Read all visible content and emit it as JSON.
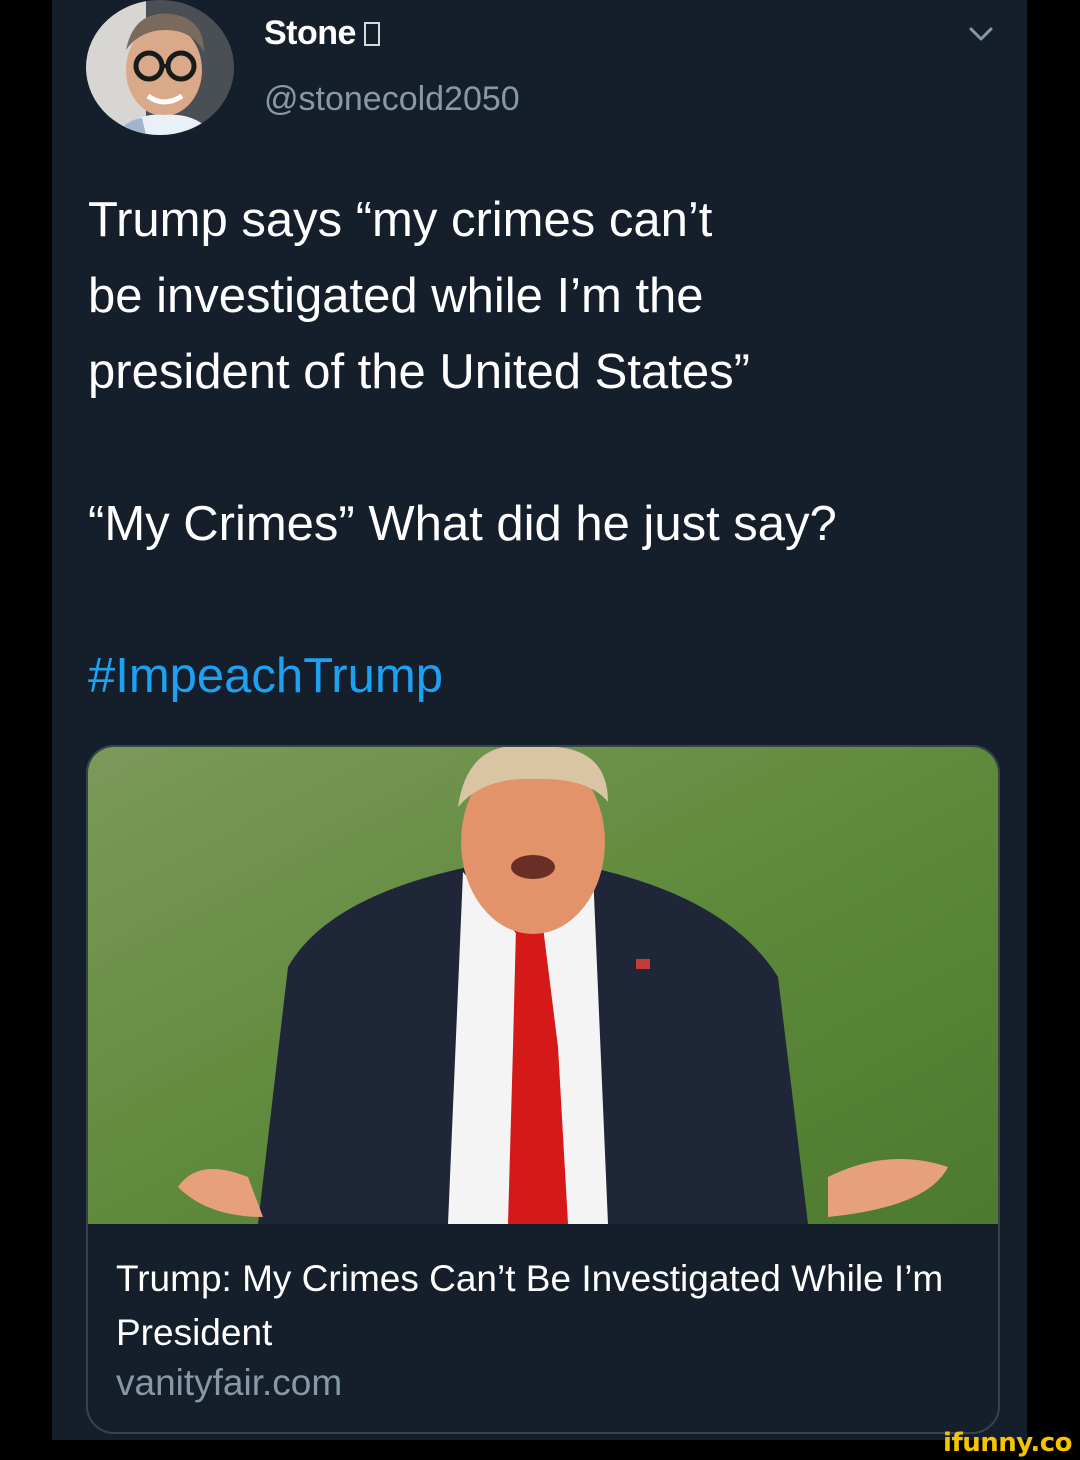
{
  "tweet": {
    "display_name": "Stone",
    "handle": "@stonecold2050",
    "text_lines": [
      "Trump says “my crimes can’t",
      "be investigated while I’m the",
      "president of the United States”"
    ],
    "text_line2": "“My Crimes” What did he just say?",
    "hashtag": "#ImpeachTrump",
    "icons": {
      "avatar": "profile-photo",
      "menu": "chevron-down-icon"
    }
  },
  "card": {
    "title": "Trump: My Crimes Can’t Be Investigated While I’m President",
    "domain": "vanityfair.com"
  },
  "watermark": "ifunny.co",
  "colors": {
    "background": "#151f2b",
    "border": "#38444d",
    "secondary_text": "#8899a6",
    "hashtag": "#1da1f2",
    "watermark": "#f5c400"
  }
}
